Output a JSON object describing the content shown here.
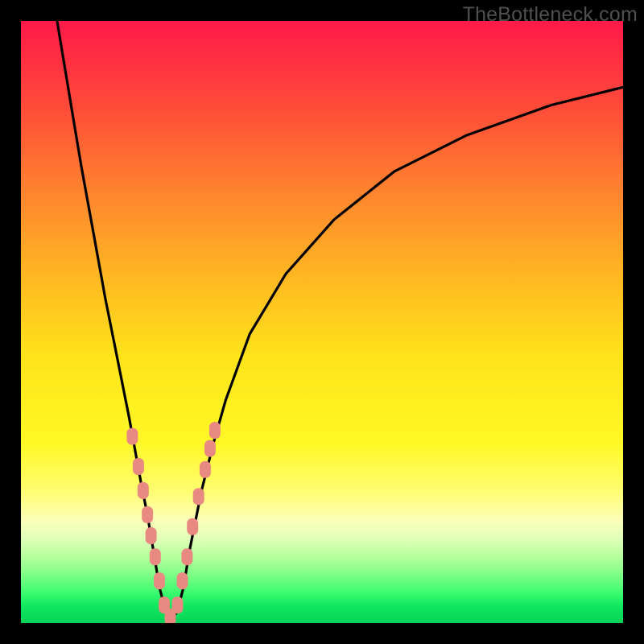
{
  "watermark": "TheBottleneck.com",
  "colors": {
    "curve_stroke": "#000000",
    "marker_fill": "#e98a82",
    "marker_stroke": "#e98a82"
  },
  "chart_data": {
    "type": "line",
    "title": "",
    "xlabel": "",
    "ylabel": "",
    "xlim": [
      0,
      100
    ],
    "ylim": [
      0,
      100
    ],
    "note": "No axes or tick labels are rendered; values estimated from pixel positions on a 0–100 scale. Curve is V-shaped with minimum near x≈24, y≈0.",
    "series": [
      {
        "name": "bottleneck-curve",
        "x": [
          6.0,
          8.0,
          10.0,
          12.0,
          14.0,
          16.0,
          18.0,
          20.0,
          21.0,
          22.0,
          23.0,
          24.0,
          25.0,
          26.0,
          27.0,
          28.0,
          30.0,
          32.0,
          34.0,
          38.0,
          44.0,
          52.0,
          62.0,
          74.0,
          88.0,
          100.0
        ],
        "y": [
          100.0,
          88.0,
          76.0,
          65.0,
          54.0,
          44.0,
          34.0,
          23.0,
          18.0,
          12.0,
          6.0,
          2.0,
          0.5,
          2.0,
          6.0,
          12.0,
          22.0,
          30.0,
          37.0,
          48.0,
          58.0,
          67.0,
          75.0,
          81.0,
          86.0,
          89.0
        ]
      }
    ],
    "markers": {
      "name": "highlighted-points",
      "x": [
        18.5,
        19.5,
        20.3,
        21.0,
        21.6,
        22.3,
        23.0,
        23.8,
        24.8,
        26.0,
        26.8,
        27.6,
        28.5,
        29.5,
        30.6,
        31.4,
        32.2
      ],
      "y": [
        31.0,
        26.0,
        22.0,
        18.0,
        14.5,
        11.0,
        7.0,
        3.0,
        1.0,
        3.0,
        7.0,
        11.0,
        16.0,
        21.0,
        25.5,
        29.0,
        32.0
      ]
    }
  }
}
